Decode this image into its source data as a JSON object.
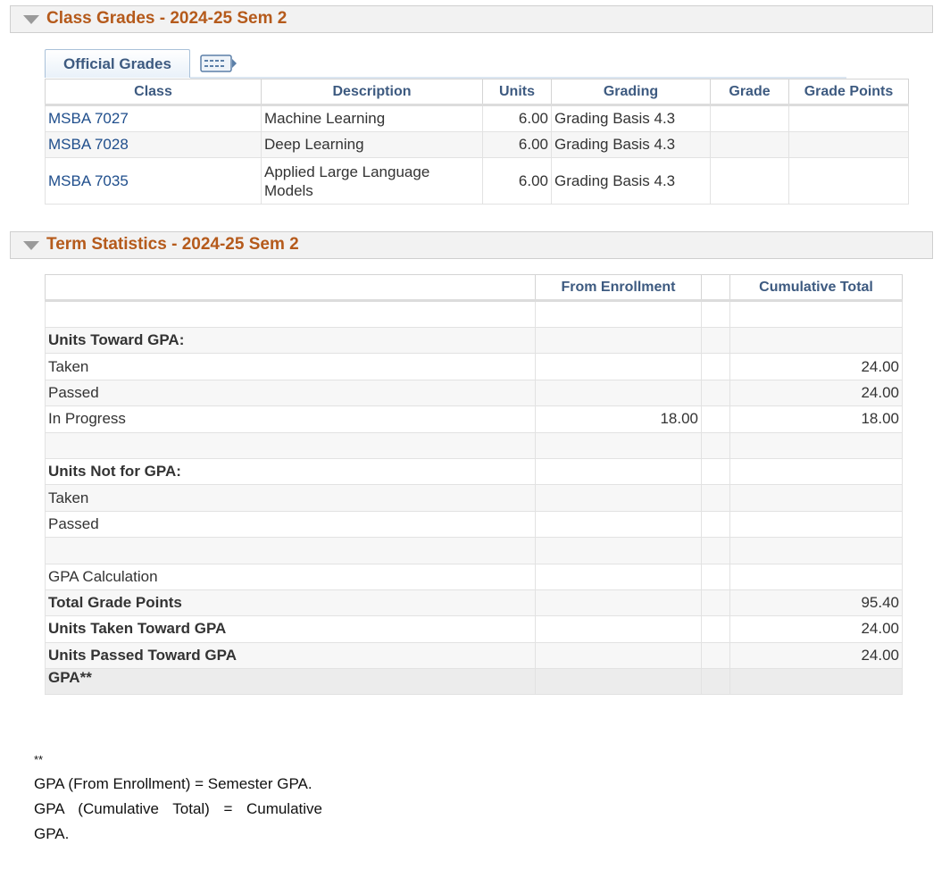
{
  "class_grades": {
    "title": "Class Grades - 2024-25 Sem 2",
    "tab_label": "Official Grades",
    "columns": [
      "Class",
      "Description",
      "Units",
      "Grading",
      "Grade",
      "Grade Points"
    ],
    "rows": [
      {
        "class": "MSBA 7027",
        "description": "Machine Learning",
        "units": "6.00",
        "grading": "Grading Basis 4.3",
        "grade": "",
        "grade_points": ""
      },
      {
        "class": "MSBA 7028",
        "description": "Deep Learning",
        "units": "6.00",
        "grading": "Grading Basis 4.3",
        "grade": "",
        "grade_points": ""
      },
      {
        "class": "MSBA 7035",
        "description": "Applied Large Language Models",
        "units": "6.00",
        "grading": "Grading Basis 4.3",
        "grade": "",
        "grade_points": ""
      }
    ]
  },
  "term_statistics": {
    "title": "Term Statistics - 2024-25 Sem 2",
    "columns": [
      "",
      "From Enrollment",
      "",
      "Cumulative Total"
    ],
    "rows": [
      {
        "label": "",
        "from": "",
        "cum": ""
      },
      {
        "label": "Units Toward GPA:",
        "from": "",
        "cum": ""
      },
      {
        "label": "Taken",
        "from": "",
        "cum": "24.00"
      },
      {
        "label": "Passed",
        "from": "",
        "cum": "24.00"
      },
      {
        "label": "In Progress",
        "from": "18.00",
        "cum": "18.00"
      },
      {
        "label": "",
        "from": "",
        "cum": ""
      },
      {
        "label": "Units Not for GPA:",
        "from": "",
        "cum": ""
      },
      {
        "label": "Taken",
        "from": "",
        "cum": ""
      },
      {
        "label": "Passed",
        "from": "",
        "cum": ""
      },
      {
        "label": "",
        "from": "",
        "cum": ""
      },
      {
        "label": "GPA Calculation",
        "from": "",
        "cum": ""
      },
      {
        "label": "Total Grade Points",
        "from": "",
        "cum": "95.40"
      },
      {
        "label": "Units Taken Toward GPA",
        "from": "",
        "cum": "24.00"
      },
      {
        "label": "Units Passed Toward GPA",
        "from": "",
        "cum": "24.00"
      },
      {
        "label": "GPA**",
        "from": "",
        "cum": ""
      }
    ]
  },
  "footnote": {
    "marker": "**",
    "line1": "GPA (From Enrollment) = Semester GPA.",
    "line2": "GPA (Cumulative Total) = Cumulative GPA."
  }
}
